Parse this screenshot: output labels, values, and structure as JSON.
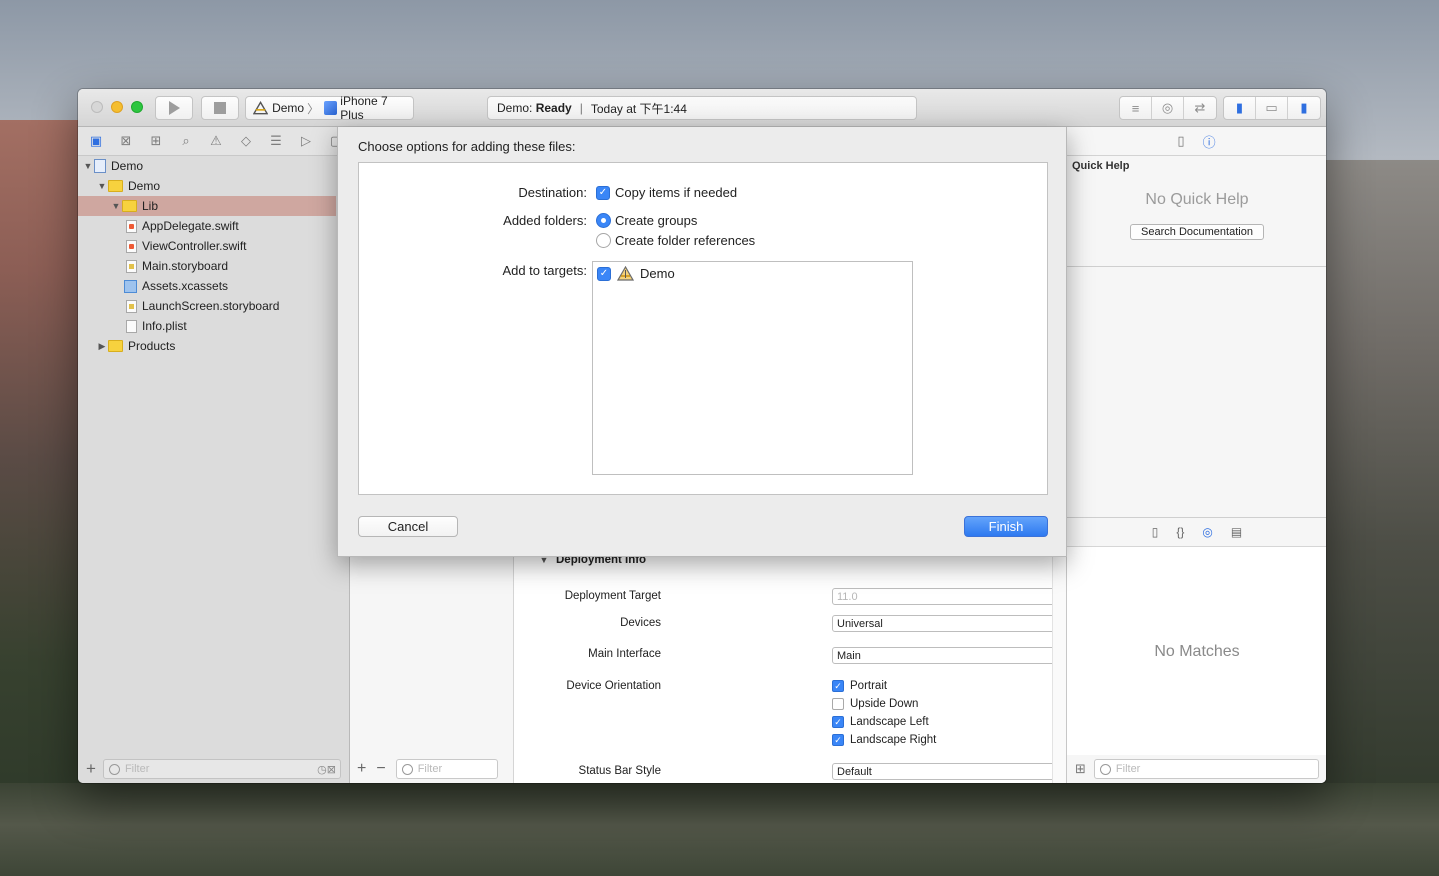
{
  "toolbar": {
    "scheme": "Demo",
    "device": "iPhone 7 Plus",
    "status_app": "Demo:",
    "status_state": "Ready",
    "status_time": "Today at 下午1:44"
  },
  "navigator": {
    "items": [
      {
        "label": "Demo",
        "kind": "project",
        "indent": 0,
        "disclosure": "open"
      },
      {
        "label": "Demo",
        "kind": "folder",
        "indent": 1,
        "disclosure": "open"
      },
      {
        "label": "Lib",
        "kind": "folder",
        "indent": 2,
        "disclosure": "open",
        "selected": true
      },
      {
        "label": "AppDelegate.swift",
        "kind": "swift",
        "indent": 3
      },
      {
        "label": "ViewController.swift",
        "kind": "swift",
        "indent": 3
      },
      {
        "label": "Main.storyboard",
        "kind": "storyboard",
        "indent": 3
      },
      {
        "label": "Assets.xcassets",
        "kind": "assets",
        "indent": 3
      },
      {
        "label": "LaunchScreen.storyboard",
        "kind": "storyboard",
        "indent": 3
      },
      {
        "label": "Info.plist",
        "kind": "plist",
        "indent": 3
      },
      {
        "label": "Products",
        "kind": "folder",
        "indent": 1,
        "disclosure": "closed"
      }
    ],
    "filter_placeholder": "Filter"
  },
  "targets_list": {
    "filter_placeholder": "Filter"
  },
  "settings": {
    "section_title": "Deployment Info",
    "deployment_target_label": "Deployment Target",
    "deployment_target_value": "11.0",
    "devices_label": "Devices",
    "devices_value": "Universal",
    "main_interface_label": "Main Interface",
    "main_interface_value": "Main",
    "orientation_label": "Device Orientation",
    "orientations": [
      {
        "label": "Portrait",
        "checked": true
      },
      {
        "label": "Upside Down",
        "checked": false
      },
      {
        "label": "Landscape Left",
        "checked": true
      },
      {
        "label": "Landscape Right",
        "checked": true
      }
    ],
    "status_bar_label": "Status Bar Style",
    "status_bar_value": "Default"
  },
  "inspector": {
    "quick_help_title": "Quick Help",
    "no_quick_help": "No Quick Help",
    "search_docs": "Search Documentation",
    "no_matches": "No Matches",
    "filter_placeholder": "Filter"
  },
  "dialog": {
    "title": "Choose options for adding these files:",
    "destination_label": "Destination:",
    "copy_items": "Copy items if needed",
    "added_folders_label": "Added folders:",
    "create_groups": "Create groups",
    "create_folder_refs": "Create folder references",
    "add_targets_label": "Add to targets:",
    "target_name": "Demo",
    "cancel": "Cancel",
    "finish": "Finish"
  }
}
